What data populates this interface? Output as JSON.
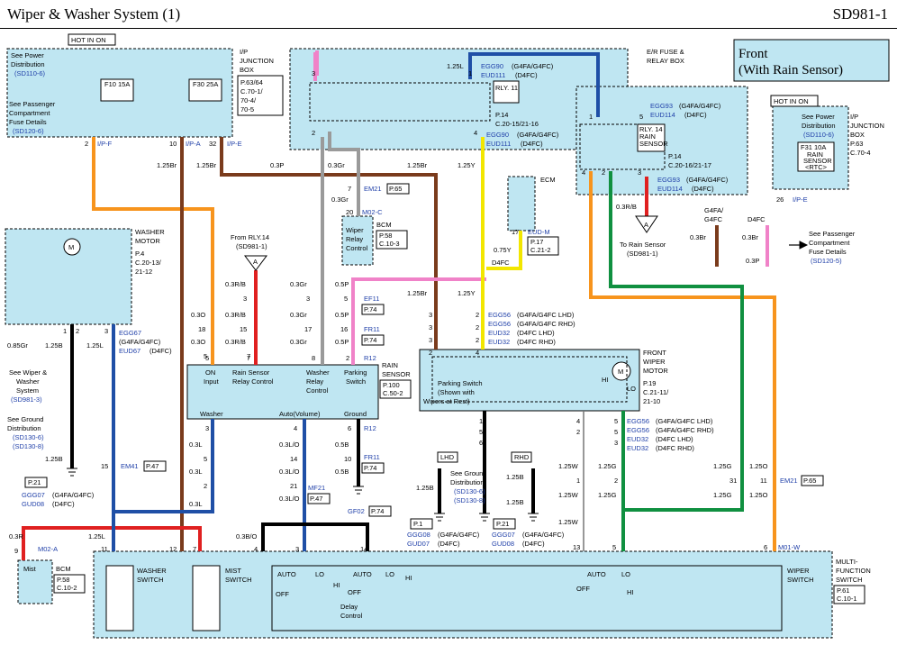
{
  "header": {
    "title": "Wiper & Washer System (1)",
    "page_code": "SD981-1"
  },
  "front_title": [
    "Front",
    "(With Rain Sensor)"
  ],
  "ip_junction_box": {
    "hot_label": "HOT IN ON",
    "name": [
      "I/P",
      "JUNCTION",
      "BOX"
    ],
    "ref": [
      "P.63/64",
      "C.70-1/",
      "70-4/",
      "70-5"
    ],
    "see_power": [
      "See Power",
      "Distribution",
      "(SD110-6)"
    ],
    "see_passenger": [
      "See Passenger",
      "Compartment",
      "Fuse Details",
      "(SD120-6)"
    ],
    "fuse1": "F10 15A",
    "fuse2": "F30 25A",
    "pins": [
      "2",
      "I/P-F",
      "10",
      "I/P-A",
      "32",
      "I/P-E"
    ]
  },
  "er_fuse_box": {
    "name": [
      "E/R FUSE &",
      "RELAY BOX"
    ],
    "rly11": "RLY. 11",
    "rly11_ref": [
      "P.14",
      "C.20-15/21-16"
    ],
    "rly14": [
      "RLY. 14",
      "RAIN",
      "SENSOR"
    ],
    "rly14_ref": [
      "P.14",
      "C.20-16/21-17"
    ],
    "egg90_a": "EGG90",
    "egg90_a_t": "(G4FA/G4FC)",
    "eud111_a": "EUD111",
    "eud111_a_t": "(D4FC)",
    "egg90_b": "EGG90",
    "egg90_b_t": "(G4FA/G4FC)",
    "eud111_b": "EUD111",
    "eud111_b_t": "(D4FC)",
    "egg93_a": "EGG93",
    "egg93_a_t": "(G4FA/G4FC)",
    "eud114_a": "EUD114",
    "eud114_a_t": "(D4FC)",
    "egg93_b": "EGG93",
    "egg93_b_t": "(G4FA/G4FC)",
    "eud114_b": "EUD114",
    "eud114_b_t": "(D4FC)",
    "pins": [
      "3",
      "1",
      "2",
      "4",
      "5",
      "1",
      "5",
      "4",
      "2",
      "3"
    ]
  },
  "ip_box_right": {
    "hot_label": "HOT IN ON",
    "name": [
      "I/P",
      "JUNCTION",
      "BOX"
    ],
    "ref": [
      "P.63",
      "C.70-4"
    ],
    "see_power": [
      "See Power",
      "Distribution",
      "(SD110-6)"
    ],
    "fuse": [
      "F31 10A",
      "RAIN",
      "SENSOR",
      "<RTC>"
    ],
    "pin": "26",
    "pin_name": "I/P-E"
  },
  "wires": {
    "w125br_a": "1.25Br",
    "w125br_b": "1.25Br",
    "w03p": "0.3P",
    "w03gr": "0.3Gr",
    "w125br_c": "1.25Br",
    "w125y": "1.25Y",
    "w125l": "1.25L",
    "w03rb": "0.3R/B",
    "w03br": "0.3Br",
    "w03br2": "0.3Br",
    "w03p2": "0.3P",
    "g4fa_g4fc": [
      "G4FA/",
      "G4FC"
    ],
    "d4fc": "D4FC"
  },
  "ecm": {
    "name": "ECM",
    "pin": "17",
    "conn": "EUD-M",
    "ref": [
      "P.17",
      "C.21-2"
    ],
    "w075y": "0.75Y",
    "d4fc": "D4FC"
  },
  "bcm_relay": {
    "em21": "EM21",
    "em21_ref": "P.65",
    "pin7": "7",
    "w03gr": "0.3Gr",
    "pin20": "20",
    "m02c": "M02-C",
    "name": "BCM",
    "label": [
      "Wiper",
      "Relay",
      "Control"
    ],
    "ref": [
      "P.58",
      "C.10-3"
    ]
  },
  "to_rain_sensor": {
    "pin": "A",
    "text": [
      "To Rain Sensor",
      "(SD981-1)"
    ]
  },
  "see_passenger_right": [
    "See Passenger",
    "Compartment",
    "Fuse Details",
    "(SD120-5)"
  ],
  "washer_motor": {
    "name": [
      "WASHER",
      "MOTOR"
    ],
    "ref": [
      "P.4",
      "C.20-13/",
      "21-12"
    ],
    "pins": [
      "1",
      "2",
      "3"
    ],
    "motor": "M"
  },
  "from_rly14": {
    "text": [
      "From RLY.14",
      "(SD981-1)"
    ],
    "pin": "A"
  },
  "left_wires": {
    "w03o_a": "0.3O",
    "w03o_b": "0.3O",
    "pin18": "18",
    "pin5": "5",
    "w085gr": "0.85Gr",
    "w125b": "1.25B",
    "w125l": "1.25L"
  },
  "egg67": "EGG67",
  "egg67_t": "(G4FA/G4FC)",
  "eud67": "EUD67",
  "eud67_t": "(D4FC)",
  "see_wiper": [
    "See Wiper &",
    "Washer",
    "System",
    "(SD981-3)"
  ],
  "see_ground_left": [
    "See Ground",
    "Distribution",
    "(SD130-6)",
    "(SD130-8)"
  ],
  "ground_left": {
    "w125b": "1.25B",
    "ref": "P.21",
    "ggg07": "GGG07",
    "ggg07_t": "(G4FA/G4FC)",
    "gud08": "GUD08",
    "gud08_t": "(D4FC)"
  },
  "em41": {
    "pin": "15",
    "name": "EM41",
    "ref": "P.47"
  },
  "rain_sensor": {
    "name": [
      "RAIN",
      "SENSOR"
    ],
    "ref": [
      "P.100",
      "C.50-2"
    ],
    "labels_top": [
      "ON",
      "Input",
      "Rain Sensor",
      "Relay Control",
      "Washer",
      "Relay",
      "Control",
      "Parking",
      "Switch"
    ],
    "labels_bot": [
      "Washer",
      "Auto(Volume)",
      "Ground"
    ],
    "top_pins": [
      "5",
      "7",
      "8",
      "2",
      "R12"
    ],
    "bot_pins": [
      "3",
      "4",
      "6",
      "R12"
    ]
  },
  "rs_wires": {
    "rb1": "0.3R/B",
    "rb2": "0.3R/B",
    "rb3": "0.3R/B",
    "gr1": "0.3Gr",
    "gr2": "0.3Gr",
    "gr3": "0.3Gr",
    "p1": "0.5P",
    "p2": "0.5P",
    "p3": "0.5P",
    "n3a": "3",
    "n3b": "3",
    "n15": "15",
    "n17": "17",
    "n16": "16",
    "n5": "5",
    "n7": "7",
    "ef11": "EF11",
    "fr11": "FR11",
    "ref74a": "P.74",
    "ref74b": "P.74"
  },
  "rs_bottom": {
    "w03l_a": "0.3L",
    "w03l_b": "0.3L",
    "w03l_c": "0.3L",
    "w03lo_a": "0.3L/O",
    "w03lo_b": "0.3L/O",
    "w03lo_c": "0.3L/O",
    "w05b_a": "0.5B",
    "w05b_b": "0.5B",
    "n3": "3",
    "n5a": "5",
    "n2": "2",
    "n15": "15",
    "n14": "14",
    "n21": "21",
    "n6": "6",
    "n10": "10",
    "mf21": "MF21",
    "mf21_ref": "P.47",
    "fr11": "FR11",
    "fr11_ref": "P.74",
    "gf02": "GF02",
    "gf02_ref": "P.74"
  },
  "front_wiper_motor": {
    "name": [
      "FRONT",
      "WIPER",
      "MOTOR"
    ],
    "ref": [
      "P.19",
      "C.21-11/",
      "21-10"
    ],
    "parking": [
      "Parking Switch",
      "(Shown with",
      "Wipers at Rest)"
    ],
    "hi": "HI",
    "lo": "LO",
    "motor": "M",
    "pins_top": [
      "3",
      "3",
      "3",
      "2",
      "2",
      "2",
      "2",
      "4"
    ],
    "pins_bot": [
      "1",
      "5",
      "6",
      "4",
      "2",
      "5",
      "5",
      "3"
    ]
  },
  "egg56": [
    [
      "EGG56",
      "(G4FA/G4FC LHD)"
    ],
    [
      "EGG56",
      "(G4FA/G4FC RHD)"
    ],
    [
      "EUD32",
      "(D4FC LHD)"
    ],
    [
      "EUD32",
      "(D4FC RHD)"
    ]
  ],
  "egg56_b": [
    [
      "EGG56",
      "(G4FA/G4FC LHD)"
    ],
    [
      "EGG56",
      "(G4FA/G4FC RHD)"
    ],
    [
      "EUD32",
      "(D4FC LHD)"
    ],
    [
      "EUD32",
      "(D4FC RHD)"
    ]
  ],
  "mid_wires": {
    "w125br": "1.25Br",
    "w125y": "1.25Y"
  },
  "ground_mid": {
    "lhd": "LHD",
    "rhd": "RHD",
    "see_ground": [
      "See Ground",
      "Distribution",
      "(SD130-6)",
      "(SD130-8)"
    ],
    "w125b_a": "1.25B",
    "w125b_b": "1.25B",
    "w125b_c": "1.25B",
    "ref_a": "P.1",
    "ggg08": "GGG08",
    "ggg08_t": "(G4FA/G4FC)",
    "gud07": "GUD07",
    "gud07_t": "(D4FC)",
    "ref_b": "P.21",
    "ggg07": "GGG07",
    "ggg07_t": "(G4FA/G4FC)",
    "gud08": "GUD08",
    "gud08_t": "(D4FC)"
  },
  "right_wires": {
    "w125w_a": "1.25W",
    "w125w_b": "1.25W",
    "w125w_c": "1.25W",
    "w125g_a": "1.25G",
    "w125g_b": "1.25G",
    "w125g_c": "1.25G",
    "w125g_d": "1.25G",
    "w125o_a": "1.25O",
    "w125o_b": "1.25O",
    "n1": "1",
    "n2": "2",
    "n3": "3",
    "n31": "31",
    "n11": "11",
    "n13": "13",
    "n5": "5",
    "n6": "6",
    "em21": "EM21",
    "em21_ref": "P.65",
    "m01w": "M01-W"
  },
  "bottom": {
    "w03r": "0.3R",
    "w125l": "1.25L",
    "w03bo": "0.3B/O",
    "m02a": "M02-A",
    "mist": "Mist",
    "bcm": "BCM",
    "bcm_ref": [
      "P.58",
      "C.10-2"
    ],
    "pins": [
      "9",
      "11",
      "12",
      "7",
      "4",
      "3",
      "14",
      "13",
      "5",
      "6"
    ],
    "washer_switch": [
      "WASHER",
      "SWITCH"
    ],
    "mist_switch": [
      "MIST",
      "SWITCH"
    ],
    "wiper_switch": [
      "WIPER",
      "SWITCH"
    ],
    "mfs": [
      "MULTI-",
      "FUNCTION",
      "SWITCH"
    ],
    "mfs_ref": [
      "P.61",
      "C.10-1"
    ],
    "auto": "AUTO",
    "auto2": "AUTO",
    "auto3": "AUTO",
    "lo": "LO",
    "lo2": "LO",
    "lo3": "LO",
    "hi": "HI",
    "hi2": "HI",
    "hi3": "HI",
    "off": "OFF",
    "off2": "OFF",
    "off3": "OFF",
    "delay": [
      "Delay",
      "Control"
    ]
  },
  "colors": {
    "brown": "#7a3b1c",
    "orange": "#f7941d",
    "gray": "#9a9a9a",
    "pink": "#f082c8",
    "yellow": "#f2e600",
    "blue": "#1f4fa6",
    "red": "#e02020",
    "green": "#109040",
    "black": "#000000",
    "lightblue": "#bfe6f2",
    "darkred": "#b01818"
  }
}
